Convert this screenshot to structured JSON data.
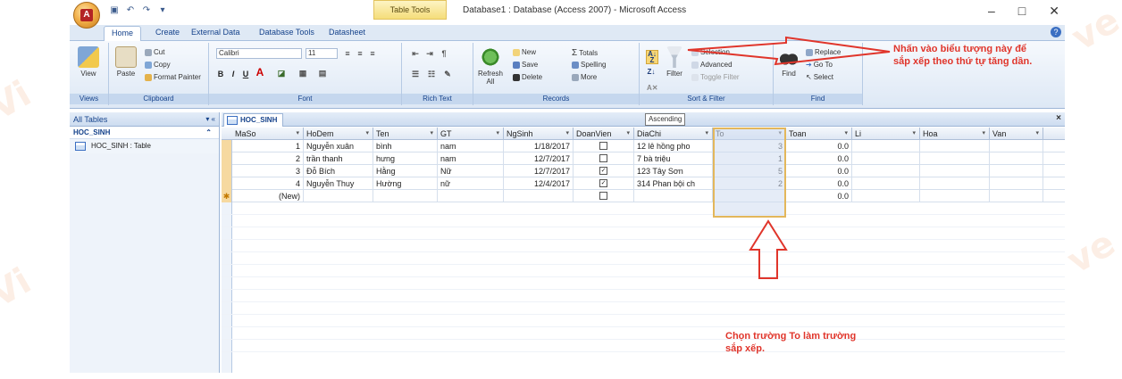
{
  "window": {
    "tool_context_label": "Table Tools",
    "title": "Database1 : Database (Access 2007) - Microsoft Access",
    "controls": [
      "–",
      "□",
      "✕"
    ]
  },
  "ribbon_tabs": [
    "Home",
    "Create",
    "External Data",
    "Database Tools",
    "Datasheet"
  ],
  "ribbon": {
    "views": {
      "view_label": "View",
      "group_label": "Views"
    },
    "clipboard": {
      "paste_label": "Paste",
      "cut_label": "Cut",
      "copy_label": "Copy",
      "format_painter_label": "Format Painter",
      "group_label": "Clipboard"
    },
    "font": {
      "font_name": "Calibri",
      "font_size": "11",
      "group_label": "Font"
    },
    "rich_text": {
      "group_label": "Rich Text"
    },
    "records": {
      "refresh_label": "Refresh All",
      "new_label": "New",
      "save_label": "Save",
      "delete_label": "Delete",
      "totals_label": "Totals",
      "spelling_label": "Spelling",
      "more_label": "More",
      "group_label": "Records"
    },
    "sort_filter": {
      "filter_label": "Filter",
      "selection_label": "Selection",
      "advanced_label": "Advanced",
      "toggle_filter_label": "Toggle Filter",
      "group_label": "Sort & Filter"
    },
    "find": {
      "find_label": "Find",
      "replace_label": "Replace",
      "goto_label": "Go To",
      "select_label": "Select",
      "group_label": "Find"
    }
  },
  "tooltip": "Ascending",
  "nav": {
    "header": "All Tables",
    "group": "HOC_SINH",
    "item": "HOC_SINH : Table"
  },
  "document_tab": "HOC_SINH",
  "table": {
    "columns": [
      "MaSo",
      "HoDem",
      "Ten",
      "GT",
      "NgSinh",
      "DoanVien",
      "DiaChi",
      "To",
      "Toan",
      "Li",
      "Hoa",
      "Van"
    ],
    "rows": [
      {
        "MaSo": "1",
        "HoDem": "Nguyễn xuân",
        "Ten": "bình",
        "GT": "nam",
        "NgSinh": "1/18/2017",
        "DoanVien": false,
        "DiaChi": "12 lê hồng pho",
        "To": "3",
        "Toan": "0.0"
      },
      {
        "MaSo": "2",
        "HoDem": "trần thanh",
        "Ten": "hưng",
        "GT": "nam",
        "NgSinh": "12/7/2017",
        "DoanVien": false,
        "DiaChi": "7 bà triệu",
        "To": "1",
        "Toan": "0.0"
      },
      {
        "MaSo": "3",
        "HoDem": "Đỗ Bích",
        "Ten": "Hằng",
        "GT": "Nữ",
        "NgSinh": "12/7/2017",
        "DoanVien": true,
        "DiaChi": "123 Tây Sơn",
        "To": "5",
        "Toan": "0.0"
      },
      {
        "MaSo": "4",
        "HoDem": "Nguyễn Thuy",
        "Ten": "Hường",
        "GT": "nữ",
        "NgSinh": "12/4/2017",
        "DoanVien": true,
        "DiaChi": "314 Phan bội ch",
        "To": "2",
        "Toan": "0.0"
      }
    ],
    "new_row": {
      "MaSo": "(New)",
      "Toan": "0.0"
    }
  },
  "annotations": {
    "top": "Nhấn vào biểu tượng này để sắp xếp theo thứ tự tăng dần.",
    "bottom": "Chọn trường To làm trường sắp xếp."
  },
  "accent_colors": {
    "annotation": "#e0352b",
    "highlight": "#e3b75b"
  },
  "watermark_text": "Vietjack"
}
